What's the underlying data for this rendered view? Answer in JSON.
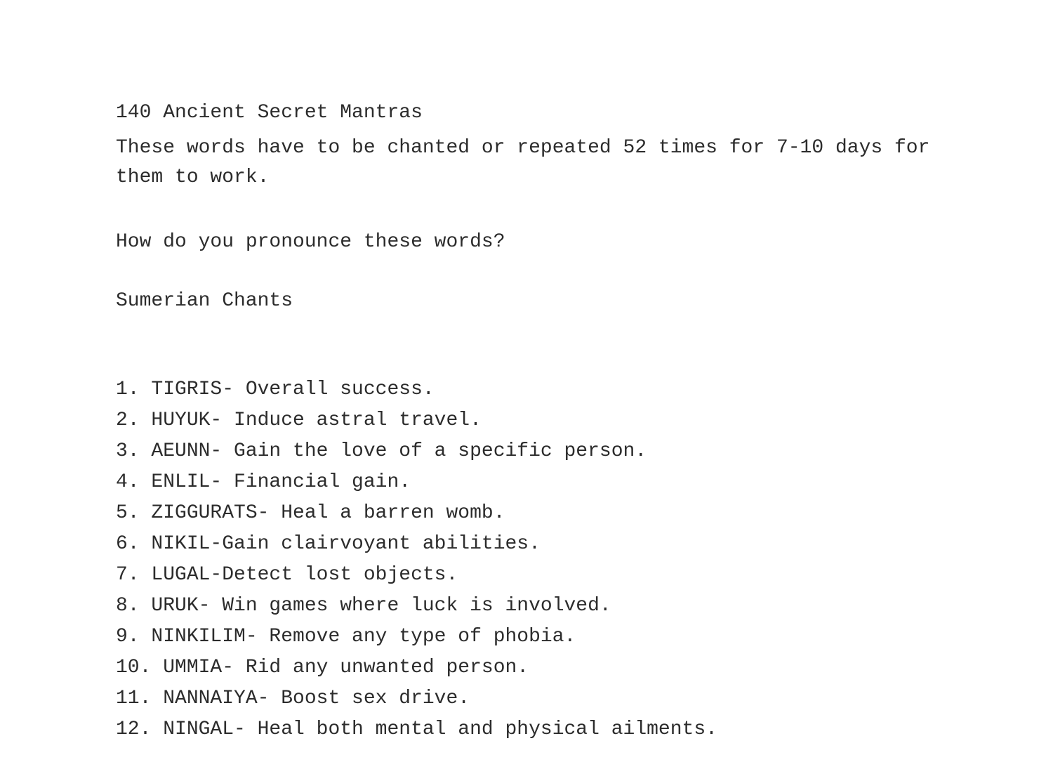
{
  "page": {
    "title": "140 Ancient Secret Mantras",
    "description_line1": "These words have to be chanted or repeated 52 times for 7-10 days for",
    "description_line2": "them to work.",
    "pronunciation_question": "How do you pronounce these words?",
    "section_title": "Sumerian Chants",
    "items": [
      {
        "number": "1.",
        "text": "TIGRIS- Overall success."
      },
      {
        "number": "2.",
        "text": "HUYUK- Induce astral travel."
      },
      {
        "number": "3.",
        "text": "AEUNN- Gain the love of a specific person."
      },
      {
        "number": "4.",
        "text": "ENLIL- Financial gain."
      },
      {
        "number": "5.",
        "text": "ZIGGURATS- Heal a barren womb."
      },
      {
        "number": "6.",
        "text": "NIKIL-Gain clairvoyant abilities."
      },
      {
        "number": "7.",
        "text": "LUGAL-Detect lost objects."
      },
      {
        "number": "8.",
        "text": "URUK- Win games where luck is involved."
      },
      {
        "number": "9.",
        "text": "NINKILIM- Remove any type of phobia."
      },
      {
        "number": "10.",
        "text": "UMMIA- Rid any unwanted person."
      },
      {
        "number": "11.",
        "text": "NANNAIYA- Boost sex drive."
      },
      {
        "number": "12.",
        "text": "NINGAL- Heal both mental and physical ailments."
      }
    ]
  }
}
